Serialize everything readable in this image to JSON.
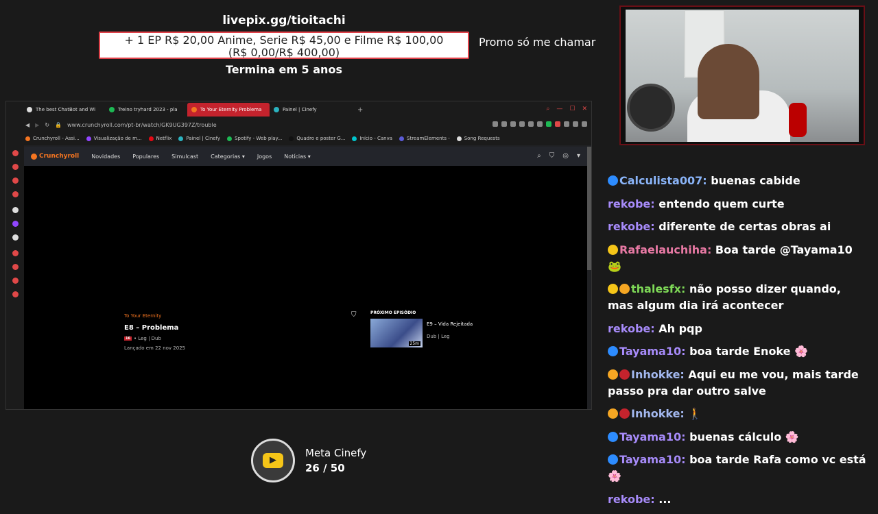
{
  "goal_top": {
    "url": "livepix.gg/tioitachi",
    "line1": "+ 1 EP R$ 20,00 Anime, Serie R$ 45,00 e Filme R$ 100,00",
    "line2": "(R$ 0,00/R$ 400,00)",
    "ends": "Termina em 5 anos",
    "progress": 0
  },
  "promo": "Promo só me chamar",
  "browser": {
    "tabs": [
      {
        "label": "The best ChatBot and Wi",
        "color": "#ddd"
      },
      {
        "label": "Treino tryhard 2023 - pla",
        "color": "#1db954"
      },
      {
        "label": "To Your Eternity Problema",
        "color": "#f47521"
      },
      {
        "label": "Painel | Cinefy",
        "color": "#2bb3c0"
      }
    ],
    "url": "www.crunchyroll.com/pt-br/watch/GK9UG397Z/trouble",
    "bookmarks": [
      {
        "label": "Crunchyroll - Assi...",
        "color": "#f47521"
      },
      {
        "label": "Visualização de m...",
        "color": "#9146ff"
      },
      {
        "label": "Netflix",
        "color": "#e50914"
      },
      {
        "label": "Painel | Cinefy",
        "color": "#2bb3c0"
      },
      {
        "label": "Spotify - Web play...",
        "color": "#1db954"
      },
      {
        "label": "Quadro e poster G...",
        "color": "#111"
      },
      {
        "label": "Início - Canva",
        "color": "#00c4cc"
      },
      {
        "label": "StreamElements -",
        "color": "#5b5bd6"
      },
      {
        "label": "Song Requests",
        "color": "#ddd"
      }
    ],
    "nav": {
      "logo": "Crunchyroll",
      "items": [
        "Novidades",
        "Populares",
        "Simulcast",
        "Categorias",
        "Jogos",
        "Notícias"
      ]
    },
    "episode": {
      "series": "To Your Eternity",
      "title": "E8 – Problema",
      "rating": "16",
      "langs": "• Leg | Dub",
      "released": "Lançado em 22 nov 2025"
    },
    "next": {
      "heading": "PRÓXIMO EPISÓDIO",
      "title": "E9 – Vida Rejeitada",
      "duration": "25m",
      "langs": "Dub | Leg"
    }
  },
  "meta": {
    "label": "Meta Cinefy",
    "count": "26 / 50"
  },
  "chat": [
    {
      "badges": [
        "#2d8cff"
      ],
      "user": "Calculista007:",
      "color": "u-blue",
      "text": "buenas cabide"
    },
    {
      "badges": [],
      "user": "rekobe:",
      "color": "u-purple",
      "text": "entendo quem curte"
    },
    {
      "badges": [],
      "user": "rekobe:",
      "color": "u-purple",
      "text": "diferente de certas obras ai"
    },
    {
      "badges": [
        "#f5c518"
      ],
      "user": "Rafaelauchiha:",
      "color": "u-pink",
      "text": "Boa tarde @Tayama10 🐸"
    },
    {
      "badges": [
        "#f5c518",
        "#f5a623"
      ],
      "user": "thalesfx:",
      "color": "u-green",
      "text": "não posso dizer quando, mas algum dia irá acontecer"
    },
    {
      "badges": [],
      "user": "rekobe:",
      "color": "u-purple",
      "text": "Ah pqp"
    },
    {
      "badges": [
        "#2d8cff"
      ],
      "user": "Tayama10:",
      "color": "u-purple",
      "text": "boa tarde Enoke 🌸"
    },
    {
      "badges": [
        "#f5a623",
        "#c4232d"
      ],
      "user": "Inhokke:",
      "color": "u-lav",
      "text": "Aqui eu me vou, mais tarde passo pra dar outro salve"
    },
    {
      "badges": [
        "#f5a623",
        "#c4232d"
      ],
      "user": "Inhokke:",
      "color": "u-lav",
      "text": "🚶"
    },
    {
      "badges": [
        "#2d8cff"
      ],
      "user": "Tayama10:",
      "color": "u-purple",
      "text": "buenas cálculo 🌸"
    },
    {
      "badges": [
        "#2d8cff"
      ],
      "user": "Tayama10:",
      "color": "u-purple",
      "text": "boa tarde Rafa como vc está 🌸"
    },
    {
      "badges": [],
      "user": "rekobe:",
      "color": "u-purple",
      "text": "..."
    }
  ]
}
